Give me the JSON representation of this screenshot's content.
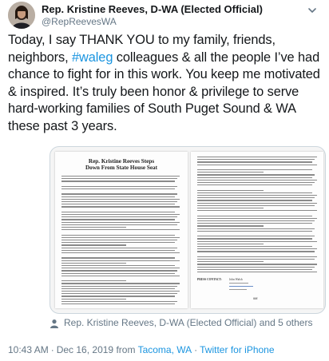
{
  "author": {
    "name": "Rep. Kristine Reeves, D-WA (Elected Official)",
    "handle": "@RepReevesWA"
  },
  "tweet": {
    "text_before_hashtag": "Today, I say THANK YOU to my family, friends, neighbors, ",
    "hashtag": "#waleg",
    "text_after_hashtag": " colleagues & all the people I’ve had chance to fight for in this work. You keep me motivated & inspired. It’s truly been honor & privilege to serve hard-working families of South Puget Sound & WA these past 3 years."
  },
  "document": {
    "title_line1": "Rep. Kristine Reeves Steps",
    "title_line2": "Down From State House Seat",
    "press_contact_label": "PRESS CONTACT:",
    "press_contact_name": "John Walsh"
  },
  "tagged": {
    "text": "Rep. Kristine Reeves, D-WA (Elected Official) and 5 others"
  },
  "meta": {
    "time": "10:43 AM",
    "date": "Dec 16, 2019",
    "from_label": "from",
    "location": "Tacoma, WA",
    "via_label": "Twitter for iPhone"
  },
  "icons": {
    "chevron": "chevron-down-icon",
    "person": "person-icon",
    "avatar": "avatar-photo"
  },
  "colors": {
    "link": "#1b95e0",
    "secondary": "#657786",
    "text": "#14171a"
  }
}
